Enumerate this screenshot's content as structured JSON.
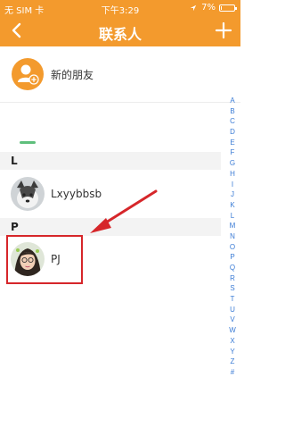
{
  "status": {
    "carrier": "无 SIM 卡",
    "time": "下午3:29",
    "battery": "7%",
    "battery_level": 0.07
  },
  "nav": {
    "title": "联系人",
    "back_icon": "chevron-left-icon",
    "add_icon": "plus-icon"
  },
  "new_friend": {
    "label": "新的朋友",
    "icon": "add-user-icon"
  },
  "sections": [
    {
      "letter": "L",
      "contacts": [
        {
          "name": "Lxyybbsb"
        }
      ]
    },
    {
      "letter": "P",
      "contacts": [
        {
          "name": "PJ"
        }
      ]
    }
  ],
  "index_letters": [
    "A",
    "B",
    "C",
    "D",
    "E",
    "F",
    "G",
    "H",
    "I",
    "J",
    "K",
    "L",
    "M",
    "N",
    "O",
    "P",
    "Q",
    "R",
    "S",
    "T",
    "U",
    "V",
    "W",
    "X",
    "Y",
    "Z",
    "#"
  ],
  "colors": {
    "accent": "#f39a2d",
    "index": "#3a7bd5",
    "highlight": "#d6262a"
  }
}
